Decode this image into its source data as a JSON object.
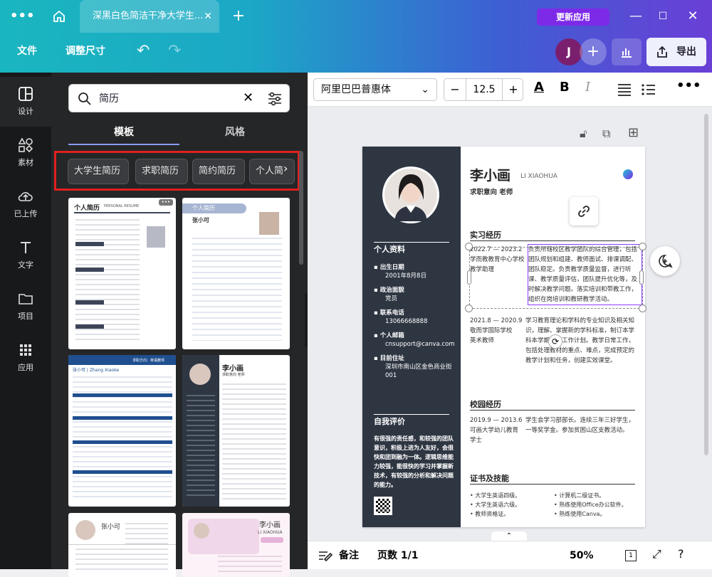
{
  "titlebar": {
    "tab_title": "深黑白色简洁干净大学生...",
    "update_label": "更新应用"
  },
  "toolbar": {
    "file": "文件",
    "resize": "调整尺寸",
    "avatar_letter": "J",
    "export": "导出"
  },
  "rail": [
    {
      "label": "设计"
    },
    {
      "label": "素材"
    },
    {
      "label": "已上传"
    },
    {
      "label": "文字"
    },
    {
      "label": "项目"
    },
    {
      "label": "应用"
    }
  ],
  "panel": {
    "search_value": "简历",
    "tabs": [
      "模板",
      "风格"
    ],
    "chips": [
      "大学生简历",
      "求职简历",
      "简约简历",
      "个人简"
    ]
  },
  "editor": {
    "font": "阿里巴巴普惠体",
    "font_size": "12.5"
  },
  "resume": {
    "name": "李小画",
    "name_en": "LI XIAOHUA",
    "intent": "求职意向 老师",
    "profile_title": "个人资料",
    "profile": [
      {
        "label": "出生日期",
        "value": "2001年8月8日"
      },
      {
        "label": "政治面貌",
        "value": "党员"
      },
      {
        "label": "联系电话",
        "value": "13066668888"
      },
      {
        "label": "个人邮箱",
        "value": "cnsupport@canva.com"
      },
      {
        "label": "目前住址",
        "value": "深圳市南山区金色商业街001"
      }
    ],
    "self_title": "自我评价",
    "self_text": "有很强的责任感，和较强的团队意识，积极上进为人友好，会很快和团到融为一体。逻辑思维能力较强，能很快的学习并掌握新技术，有较强的分析和解决问题的能力。",
    "intern_title": "实习经历",
    "intern": [
      {
        "date": "2022.7 — 2023.2",
        "org": "学而教教育中心学校",
        "role": "教学助理",
        "desc": "负责所辖校区教学团队的综合管理，包括团队规划和组建、教师面试、排课调配、团队稳定。负责教学质量监督，进行听课、教学质量评估，团队提升优化等，及时解决教学问题。落实培训和带教工作，组织在岗培训和教研教学活动。"
      },
      {
        "date": "2021.8 — 2020.9",
        "org": "敬而学国际学校",
        "role": "英术教师",
        "desc": "学习教育理论和学科的专业知识及相关知识，理解、掌握新的学科标准，制订本学科本学期教学工作计划。教学日常工作，包括处理教材的重点、难点，完成预定的教学计划和任务，创建实效课堂。"
      }
    ],
    "campus_title": "校园经历",
    "campus": [
      {
        "date": "2019.9 — 2013.6",
        "org": "可画大学幼儿教育",
        "role": "学士",
        "desc": "学生会学习部部长。连续三年三好学生，一等奖学金。参加贫困山区支教活动。"
      }
    ],
    "cert_title": "证书及技能",
    "certs": [
      "大学生英语四级。",
      "计算机二级证书。",
      "大学生英语六级。",
      "熟练使用Office办公软件。",
      "教师资格证。",
      "熟练使用Canva。"
    ]
  },
  "bottombar": {
    "notes": "备注",
    "pages": "页数 1/1",
    "zoom": "50%"
  },
  "thumbs": {
    "t1_title": "个人简历",
    "t1_sub": "PERSONAL RESUME",
    "t2_title": "个人简历",
    "t2_name": "张小可",
    "t3_name": "张小可",
    "t3_en": "Zhang Xiaoke",
    "t3_intent": "求职方向：英语教师",
    "t4_name": "李小画",
    "t4_intent": "求职意向 老师",
    "t5_name": "张小可",
    "t6_name": "李小画",
    "t6_en": "LI XIAOHUA"
  }
}
